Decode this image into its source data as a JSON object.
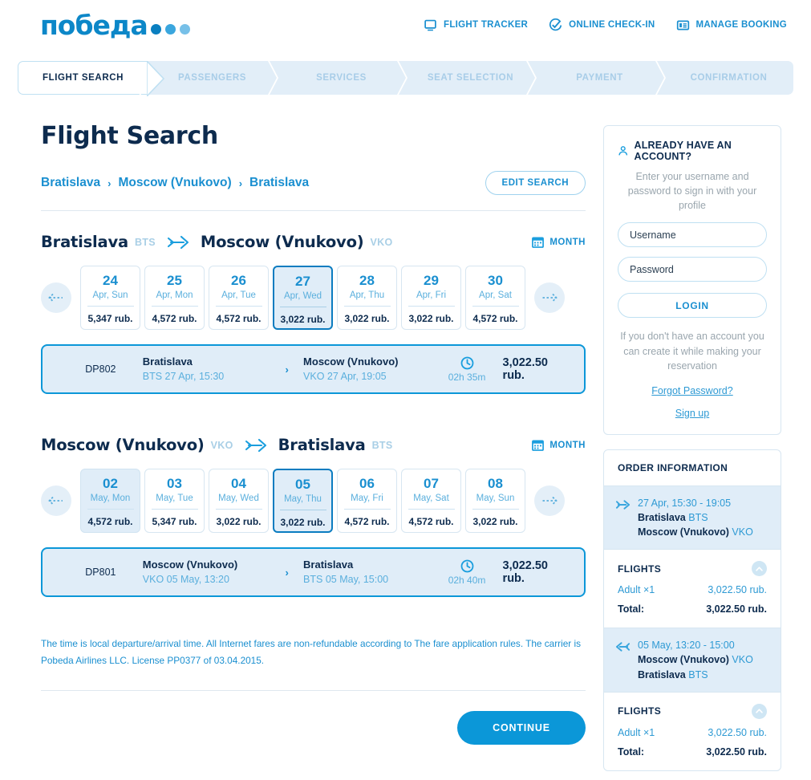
{
  "header": {
    "logo_text": "победа",
    "nav": [
      {
        "label": "FLIGHT TRACKER",
        "icon": "monitor-icon"
      },
      {
        "label": "ONLINE CHECK-IN",
        "icon": "check-circle-icon"
      },
      {
        "label": "MANAGE BOOKING",
        "icon": "id-card-icon"
      }
    ]
  },
  "steps": [
    {
      "label": "FLIGHT SEARCH",
      "active": true
    },
    {
      "label": "PASSENGERS",
      "active": false
    },
    {
      "label": "SERVICES",
      "active": false
    },
    {
      "label": "SEAT SELECTION",
      "active": false
    },
    {
      "label": "PAYMENT",
      "active": false
    },
    {
      "label": "CONFIRMATION",
      "active": false
    }
  ],
  "page_title": "Flight Search",
  "breadcrumb": {
    "items": [
      "Bratislava",
      "Moscow (Vnukovo)",
      "Bratislava"
    ],
    "separator": "›"
  },
  "edit_search_label": "EDIT SEARCH",
  "outbound": {
    "from_city": "Bratislava",
    "from_code": "BTS",
    "to_city": "Moscow (Vnukovo)",
    "to_code": "VKO",
    "month_label": "MONTH",
    "dates": [
      {
        "day": "24",
        "sub": "Apr, Sun",
        "price": "5,347 rub.",
        "state": "normal"
      },
      {
        "day": "25",
        "sub": "Apr, Mon",
        "price": "4,572 rub.",
        "state": "normal"
      },
      {
        "day": "26",
        "sub": "Apr, Tue",
        "price": "4,572 rub.",
        "state": "normal"
      },
      {
        "day": "27",
        "sub": "Apr, Wed",
        "price": "3,022 rub.",
        "state": "selected"
      },
      {
        "day": "28",
        "sub": "Apr, Thu",
        "price": "3,022 rub.",
        "state": "normal"
      },
      {
        "day": "29",
        "sub": "Apr, Fri",
        "price": "3,022 rub.",
        "state": "normal"
      },
      {
        "day": "30",
        "sub": "Apr, Sat",
        "price": "4,572 rub.",
        "state": "normal"
      }
    ],
    "flight": {
      "code": "DP802",
      "dep_city": "Bratislava",
      "dep_sub": "BTS 27 Apr, 15:30",
      "arr_city": "Moscow (Vnukovo)",
      "arr_sub": "VKO 27 Apr, 19:05",
      "arrow": "›",
      "duration": "02h 35m",
      "price": "3,022.50 rub."
    }
  },
  "inbound": {
    "from_city": "Moscow (Vnukovo)",
    "from_code": "VKO",
    "to_city": "Bratislava",
    "to_code": "BTS",
    "month_label": "MONTH",
    "dates": [
      {
        "day": "02",
        "sub": "May, Mon",
        "price": "4,572 rub.",
        "state": "hovered"
      },
      {
        "day": "03",
        "sub": "May, Tue",
        "price": "5,347 rub.",
        "state": "normal"
      },
      {
        "day": "04",
        "sub": "May, Wed",
        "price": "3,022 rub.",
        "state": "normal"
      },
      {
        "day": "05",
        "sub": "May, Thu",
        "price": "3,022 rub.",
        "state": "selected"
      },
      {
        "day": "06",
        "sub": "May, Fri",
        "price": "4,572 rub.",
        "state": "normal"
      },
      {
        "day": "07",
        "sub": "May, Sat",
        "price": "4,572 rub.",
        "state": "normal"
      },
      {
        "day": "08",
        "sub": "May, Sun",
        "price": "3,022 rub.",
        "state": "normal"
      }
    ],
    "flight": {
      "code": "DP801",
      "dep_city": "Moscow (Vnukovo)",
      "dep_sub": "VKO 05 May, 13:20",
      "arr_city": "Bratislava",
      "arr_sub": "BTS 05 May, 15:00",
      "arrow": "›",
      "duration": "02h 40m",
      "price": "3,022.50 rub."
    }
  },
  "footnote": {
    "part1": "The time is local departure/arrival time. All Internet fares are non-refundable according to ",
    "link": "The fare application rules",
    "part2": ". The carrier is Pobeda Airlines LLC. License PP0377 of 03.04.2015."
  },
  "continue_label": "CONTINUE",
  "login": {
    "title": "ALREADY HAVE AN ACCOUNT?",
    "subtitle": "Enter your username and password to sign in with your profile",
    "username_placeholder": "Username",
    "username_value": "",
    "password_placeholder": "Password",
    "password_value": "",
    "login_label": "LOGIN",
    "note": "If you don't have an account you can create it while making your reservation",
    "forgot_label": "Forgot Password?",
    "signup_label": "Sign up"
  },
  "order": {
    "title": "ORDER INFORMATION",
    "legs": [
      {
        "time": "27 Apr, 15:30 - 19:05",
        "from_city": "Bratislava",
        "from_code": "BTS",
        "to_city": "Moscow (Vnukovo)",
        "to_code": "VKO",
        "direction": "outbound",
        "flights_label": "FLIGHTS",
        "pax_label": "Adult ×1",
        "pax_price": "3,022.50 rub.",
        "total_label": "Total:",
        "total_price": "3,022.50 rub."
      },
      {
        "time": "05 May, 13:20 - 15:00",
        "from_city": "Moscow (Vnukovo)",
        "from_code": "VKO",
        "to_city": "Bratislava",
        "to_code": "BTS",
        "direction": "inbound",
        "flights_label": "FLIGHTS",
        "pax_label": "Adult ×1",
        "pax_price": "3,022.50 rub.",
        "total_label": "Total:",
        "total_price": "3,022.50 rub."
      }
    ]
  },
  "colors": {
    "brand_blue": "#0b97d8",
    "dark_navy": "#0d2b4e",
    "light_blue_bg": "#e0edf8",
    "link_blue": "#1a8fd0",
    "muted_code": "#a9cfe6"
  }
}
